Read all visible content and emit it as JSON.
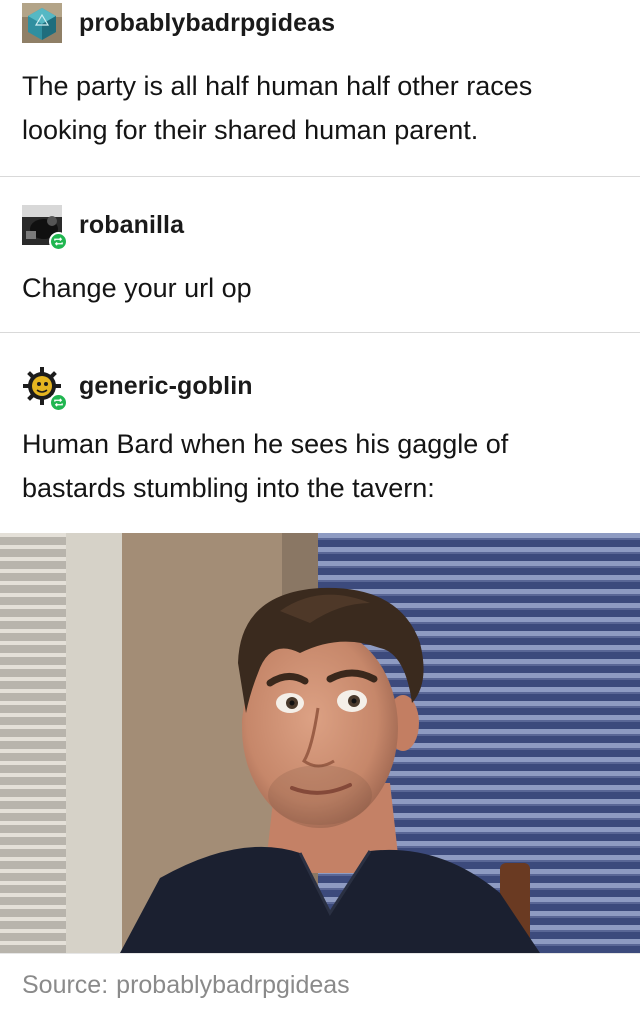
{
  "posts": [
    {
      "username": "probablybadrpgideas",
      "avatar_icon": "d20-dice-icon",
      "reblog": false,
      "text_lines": [
        "The party is all half human  half other races",
        "looking for their shared human parent."
      ]
    },
    {
      "username": "robanilla",
      "avatar_icon": "dark-photo-avatar",
      "reblog": true,
      "text_lines": [
        "Change your url op"
      ]
    },
    {
      "username": "generic-goblin",
      "avatar_icon": "goblin-gear-avatar",
      "reblog": true,
      "text_lines": [
        "Human Bard when he sees his gaggle of",
        "bastards stumbling into the tavern:"
      ]
    }
  ],
  "source": {
    "label": "Source:",
    "value": "probablybadrpgideas"
  },
  "colors": {
    "reblog_badge": "#20b650",
    "divider": "#d9d9d9",
    "source_text": "#8a8a8a"
  }
}
